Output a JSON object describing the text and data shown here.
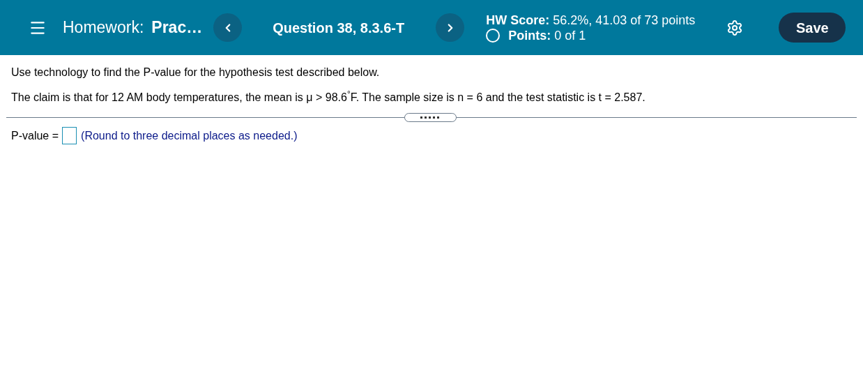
{
  "header": {
    "assignment_label": "Homework:",
    "assignment_name": "Prac…",
    "question": "Question 38, 8.3.6-T",
    "hw_score": "**HW Score:** 56.2%, 41.03 of 73 points",
    "points": "**Points:** 0 of 1",
    "save": "Save"
  },
  "question": {
    "instruction": "Use technology to find the P-value for the hypothesis test described below.",
    "claim": "The claim is that for 12 AM body temperatures, the mean is μ > 98.6$^{°}$F. The sample size is n = 6 and the test statistic is t = 2.587."
  },
  "answer": {
    "label": "P-value =",
    "hint": "(Round to three decimal places as needed.)"
  }
}
